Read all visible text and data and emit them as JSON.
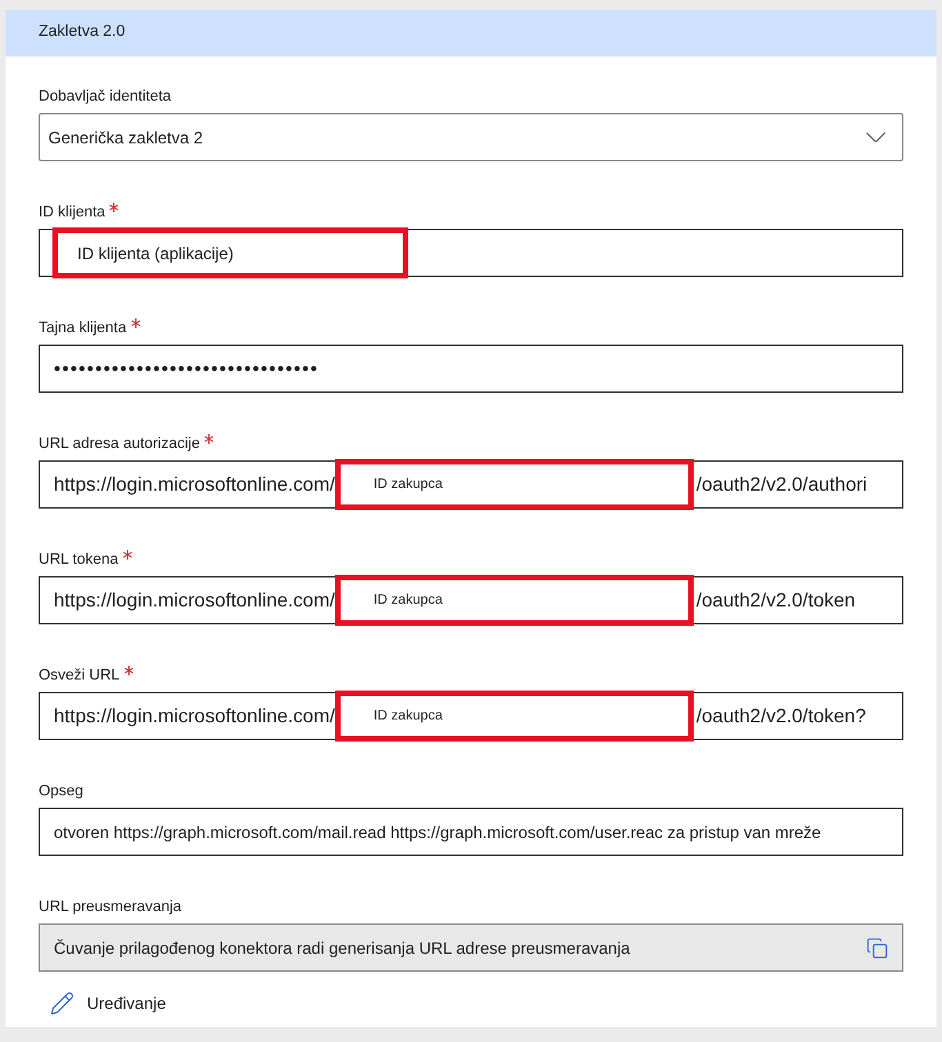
{
  "panel": {
    "title": "Zakletva 2.0"
  },
  "fields": [
    {
      "kind": "select",
      "label": "Dobavljač identiteta",
      "required": false,
      "value": "Generička zakletva 2"
    },
    {
      "kind": "text",
      "label": "ID klijenta",
      "required": true,
      "annotated": true,
      "value": "ID klijenta (aplikacije)"
    },
    {
      "kind": "password",
      "label": "Tajna klijenta",
      "required": true,
      "value": "••••••••••••••••••••••••••••••••"
    },
    {
      "kind": "url",
      "label": "URL adresa autorizacije",
      "required": true,
      "annotated": true,
      "prefix": "https://login.microsoftonline.com/",
      "tenant": "ID zakupca",
      "suffix": "/oauth2/v2.0/authori"
    },
    {
      "kind": "url",
      "label": "URL tokena",
      "required": true,
      "annotated": true,
      "prefix": "https://login.microsoftonline.com/",
      "tenant": "ID zakupca",
      "suffix": "/oauth2/v2.0/token"
    },
    {
      "kind": "url",
      "label": "Osveži URL",
      "required": true,
      "annotated": true,
      "prefix": "https://login.microsoftonline.com/",
      "tenant": "ID zakupca",
      "suffix": "/oauth2/v2.0/token?"
    },
    {
      "kind": "text",
      "label": "Opseg",
      "required": false,
      "annotated": false,
      "value": "otvoren https://graph.microsoft.com/mail.read https://graph.microsoft.com/user.reac za pristup van mreže"
    },
    {
      "kind": "readonly",
      "label": "URL preusmeravanja",
      "required": false,
      "value": "Čuvanje prilagođenog konektora radi generisanja URL adrese preusmeravanja"
    }
  ],
  "edit_link": {
    "label": "Uređivanje"
  }
}
